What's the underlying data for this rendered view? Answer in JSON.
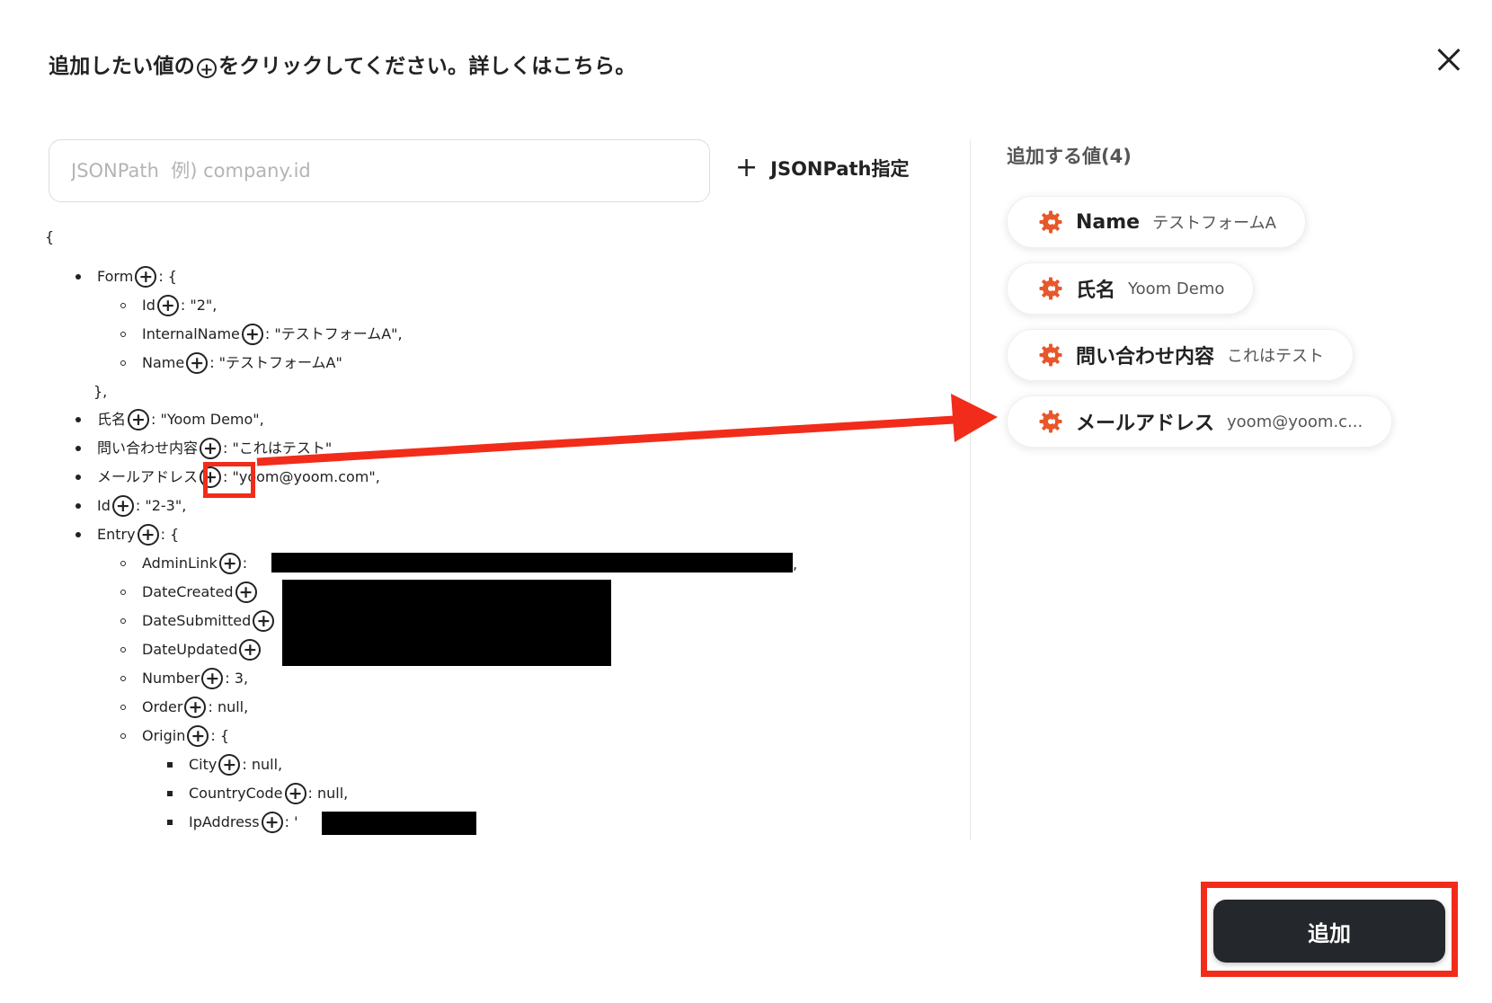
{
  "header": {
    "title_before": "追加したい値の",
    "title_plus": "+",
    "title_after": "をクリックしてください。詳しくはこちら。"
  },
  "search": {
    "placeholder": "JSONPath  例) company.id",
    "value": ""
  },
  "jsonpath_button": {
    "icon": "plus-icon",
    "label": "JSONPath指定"
  },
  "tree": {
    "open_brace": "{",
    "rows": [
      {
        "key": "Form",
        "rest": ": {"
      },
      {
        "key": "Id",
        "rest": ": \"2\","
      },
      {
        "key": "InternalName",
        "rest": ": \"テストフォームA\","
      },
      {
        "key": "Name",
        "rest": ": \"テストフォームA\""
      },
      {
        "text": "},"
      },
      {
        "key": "氏名",
        "rest": ": \"Yoom Demo\","
      },
      {
        "key": "問い合わせ内容",
        "rest": ": \"これはテスト\""
      },
      {
        "key": "メールアドレス",
        "rest": ": \"yoom@yoom.com\","
      },
      {
        "key": "Id",
        "rest": ": \"2-3\","
      },
      {
        "key": "Entry",
        "rest": ": {"
      },
      {
        "key": "AdminLink",
        "rest": ":"
      },
      {
        "key": "DateCreated",
        "rest": ""
      },
      {
        "key": "DateSubmitted",
        "rest": ""
      },
      {
        "key": "DateUpdated",
        "rest": ""
      },
      {
        "key": "Number",
        "rest": ": 3,"
      },
      {
        "key": "Order",
        "rest": ": null,"
      },
      {
        "key": "Origin",
        "rest": ": {"
      },
      {
        "key": "City",
        "rest": ": null,"
      },
      {
        "key": "CountryCode",
        "rest": ": null,"
      },
      {
        "key": "IpAddress",
        "rest": ": '"
      }
    ],
    "trailing_comma": ","
  },
  "panel": {
    "title": "追加する値(4)",
    "chips": [
      {
        "name": "Name",
        "value": "テストフォームA",
        "icon": "gear-icon"
      },
      {
        "name": "氏名",
        "value": "Yoom Demo",
        "icon": "gear-icon"
      },
      {
        "name": "問い合わせ内容",
        "value": "これはテスト",
        "icon": "gear-icon"
      },
      {
        "name": "メールアドレス",
        "value": "yoom@yoom.c...",
        "icon": "gear-icon"
      }
    ]
  },
  "add_button": {
    "label": "追加"
  },
  "colors": {
    "accent": "#e8572a",
    "highlight": "#f22c1a",
    "button_bg": "#24272b"
  }
}
